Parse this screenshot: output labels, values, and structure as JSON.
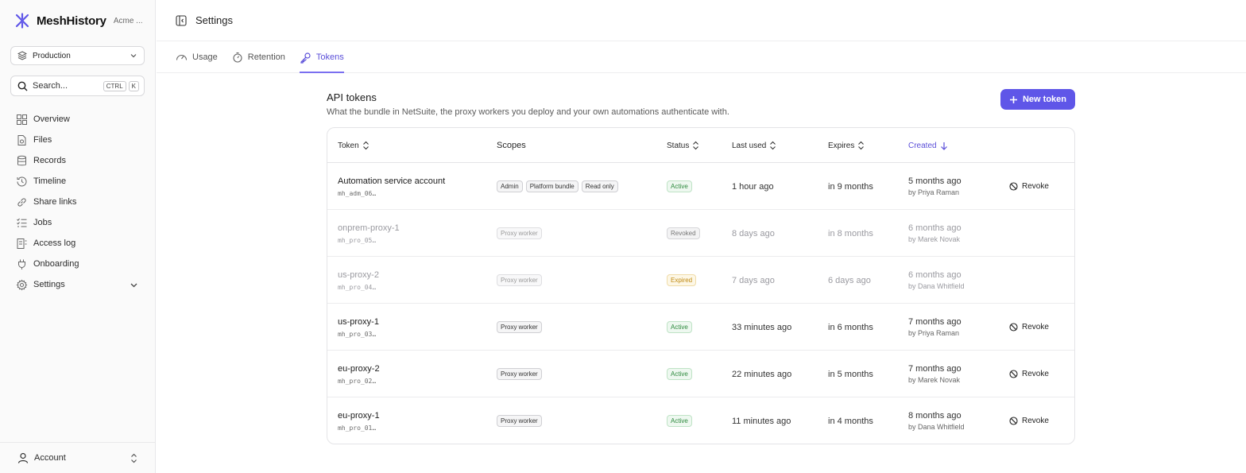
{
  "app": {
    "name": "MeshHistory",
    "org": "Acme ..."
  },
  "sidebar": {
    "environment": "Production",
    "search": {
      "placeholder": "Search...",
      "kbd1": "CTRL",
      "kbd2": "K"
    },
    "items": [
      {
        "label": "Overview",
        "icon": "grid-icon"
      },
      {
        "label": "Files",
        "icon": "file-icon"
      },
      {
        "label": "Records",
        "icon": "database-icon"
      },
      {
        "label": "Timeline",
        "icon": "history-icon"
      },
      {
        "label": "Share links",
        "icon": "link-icon"
      },
      {
        "label": "Jobs",
        "icon": "list-check-icon"
      },
      {
        "label": "Access log",
        "icon": "log-icon"
      },
      {
        "label": "Onboarding",
        "icon": "plug-icon"
      },
      {
        "label": "Settings",
        "icon": "gear-icon"
      }
    ],
    "account": "Account"
  },
  "header": {
    "title": "Settings"
  },
  "tabs": [
    {
      "label": "Usage"
    },
    {
      "label": "Retention"
    },
    {
      "label": "Tokens"
    }
  ],
  "section": {
    "title": "API tokens",
    "description": "What the bundle in NetSuite, the proxy workers you deploy and your own automations authenticate with.",
    "new_button": "New token"
  },
  "table": {
    "columns": {
      "token": "Token",
      "scopes": "Scopes",
      "status": "Status",
      "last_used": "Last used",
      "expires": "Expires",
      "created": "Created"
    },
    "revoke_label": "Revoke",
    "rows": [
      {
        "name": "Automation service account",
        "id": "mh_adm_06…",
        "scopes": [
          "Admin",
          "Platform bundle",
          "Read only"
        ],
        "status": "Active",
        "last_used": "1 hour ago",
        "expires": "in 9 months",
        "created": "5 months ago",
        "created_by": "by Priya Raman"
      },
      {
        "name": "onprem-proxy-1",
        "id": "mh_pro_05…",
        "scopes": [
          "Proxy worker"
        ],
        "status": "Revoked",
        "last_used": "8 days ago",
        "expires": "in 8 months",
        "created": "6 months ago",
        "created_by": "by Marek Novak"
      },
      {
        "name": "us-proxy-2",
        "id": "mh_pro_04…",
        "scopes": [
          "Proxy worker"
        ],
        "status": "Expired",
        "last_used": "7 days ago",
        "expires": "6 days ago",
        "created": "6 months ago",
        "created_by": "by Dana Whitfield"
      },
      {
        "name": "us-proxy-1",
        "id": "mh_pro_03…",
        "scopes": [
          "Proxy worker"
        ],
        "status": "Active",
        "last_used": "33 minutes ago",
        "expires": "in 6 months",
        "created": "7 months ago",
        "created_by": "by Priya Raman"
      },
      {
        "name": "eu-proxy-2",
        "id": "mh_pro_02…",
        "scopes": [
          "Proxy worker"
        ],
        "status": "Active",
        "last_used": "22 minutes ago",
        "expires": "in 5 months",
        "created": "7 months ago",
        "created_by": "by Marek Novak"
      },
      {
        "name": "eu-proxy-1",
        "id": "mh_pro_01…",
        "scopes": [
          "Proxy worker"
        ],
        "status": "Active",
        "last_used": "11 minutes ago",
        "expires": "in 4 months",
        "created": "8 months ago",
        "created_by": "by Dana Whitfield"
      }
    ]
  },
  "colors": {
    "accent": "#5f56e8",
    "active": "#2e8a3e",
    "expired": "#c08a12"
  }
}
